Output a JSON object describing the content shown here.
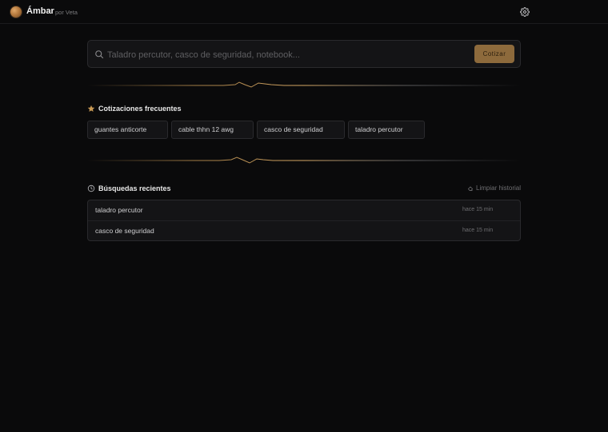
{
  "header": {
    "brand": "Ámbar",
    "byline": "por Veta"
  },
  "search": {
    "placeholder": "Taladro percutor, casco de seguridad, notebook...",
    "value": "",
    "button_label": "Cotizar"
  },
  "frequent": {
    "title": "Cotizaciones frecuentes",
    "items": [
      "guantes anticorte",
      "cable thhn 12 awg",
      "casco de seguridad",
      "taladro percutor"
    ]
  },
  "recent": {
    "title": "Búsquedas recientes",
    "clear_label": "Limpiar historial",
    "items": [
      {
        "query": "taladro percutor",
        "time": "hace 15 min"
      },
      {
        "query": "casco de seguridad",
        "time": "hace 15 min"
      }
    ]
  },
  "colors": {
    "accent": "#8d6a3c",
    "background": "#0a0a0b",
    "panel": "#141416"
  },
  "icons": {
    "logo": "amber-orb-logo",
    "settings": "gear-icon",
    "search": "search-icon",
    "frequent": "star-icon",
    "recent": "clock-icon",
    "clear": "eraser-icon"
  }
}
